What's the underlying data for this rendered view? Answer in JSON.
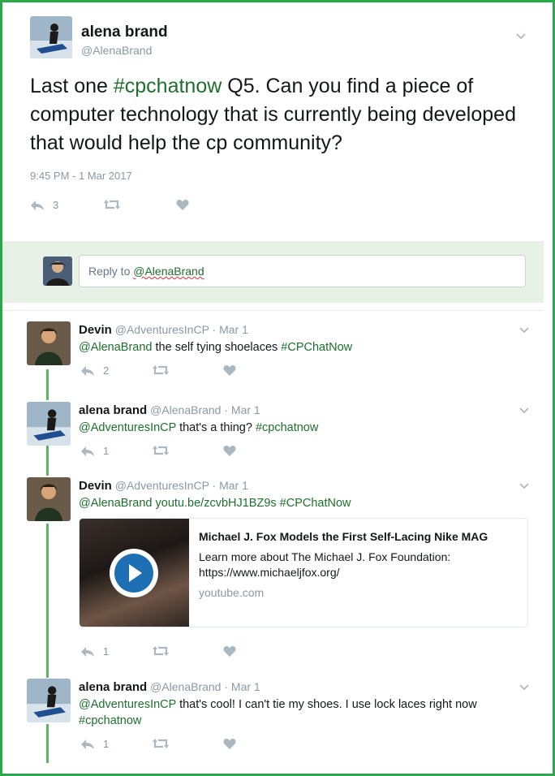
{
  "main_tweet": {
    "name": "alena brand",
    "handle": "@AlenaBrand",
    "text_pre": "Last one ",
    "hashtag": "#cpchatnow",
    "text_post": " Q5. Can you find a piece of computer technology that is currently being developed that would help the cp community?",
    "timestamp": "9:45 PM - 1 Mar 2017",
    "reply_count": "3"
  },
  "reply_box": {
    "prefix": "Reply to ",
    "mention": "@AlenaBrand"
  },
  "replies": [
    {
      "name": "Devin",
      "handle": "@AdventuresInCP",
      "date": "· Mar 1",
      "mention": "@AlenaBrand",
      "text": " the self tying shoelaces ",
      "hashtag": "#CPChatNow",
      "reply_count": "2"
    },
    {
      "name": "alena brand",
      "handle": "@AlenaBrand",
      "date": "· Mar 1",
      "mention": "@AdventuresInCP",
      "text": " that's a thing? ",
      "hashtag": "#cpchatnow",
      "reply_count": "1"
    },
    {
      "name": "Devin",
      "handle": "@AdventuresInCP",
      "date": "· Mar 1",
      "mention": "@AlenaBrand",
      "link": "youtu.be/zcvbHJ1BZ9s",
      "hashtag": "#CPChatNow",
      "reply_count": "1",
      "card": {
        "title": "Michael J. Fox Models the First Self-Lacing Nike MAG",
        "description": "Learn more about The Michael J. Fox Foundation: https://www.michaeljfox.org/",
        "domain": "youtube.com"
      }
    },
    {
      "name": "alena brand",
      "handle": "@AlenaBrand",
      "date": "· Mar 1",
      "mention": "@AdventuresInCP",
      "text": " that's cool! I can't tie my shoes. I use lock laces right now",
      "hashtag": "#cpchatnow",
      "reply_count": "1"
    }
  ],
  "icons": [
    "reply-icon",
    "retweet-icon",
    "like-icon",
    "chevron-down-icon",
    "play-icon"
  ],
  "colors": {
    "frame": "#2aa84a",
    "link": "#1e6f2d",
    "muted": "#8899a6",
    "reply_bar": "#e8f1e6"
  }
}
